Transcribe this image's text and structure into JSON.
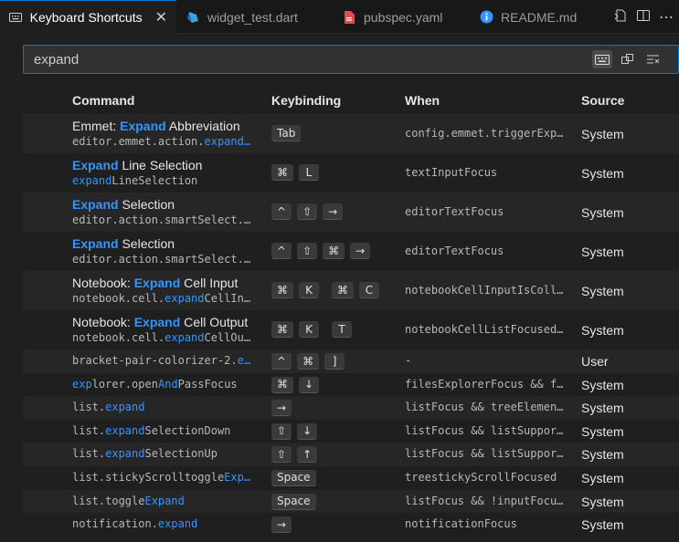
{
  "tabs": [
    {
      "label": "Keyboard Shortcuts",
      "icon": "keyboard-icon",
      "active": true
    },
    {
      "label": "widget_test.dart",
      "icon": "dart-file-icon"
    },
    {
      "label": "pubspec.yaml",
      "icon": "yaml-file-icon"
    },
    {
      "label": "README.md",
      "icon": "info-icon"
    }
  ],
  "search": {
    "value": "expand"
  },
  "headers": {
    "command": "Command",
    "keybinding": "Keybinding",
    "when": "When",
    "source": "Source"
  },
  "rows": [
    {
      "title_pre": "Emmet: ",
      "title_hl": "Expand",
      "title_post": " Abbreviation",
      "id_pre": "editor.emmet.action.",
      "id_hl": "expand…",
      "id_post": "",
      "keys": [
        [
          "Tab"
        ]
      ],
      "when": "config.emmet.triggerExp…",
      "source": "System"
    },
    {
      "title_pre": "",
      "title_hl": "Expand",
      "title_post": " Line Selection",
      "id_pre": "",
      "id_hl": "expand",
      "id_post": "LineSelection",
      "keys": [
        [
          "⌘",
          "L"
        ]
      ],
      "when": "textInputFocus",
      "source": "System"
    },
    {
      "title_pre": "",
      "title_hl": "Expand",
      "title_post": " Selection",
      "id_pre": "editor.action.smartSelect.…",
      "id_hl": "",
      "id_post": "",
      "keys": [
        [
          "^",
          "⇧",
          "→"
        ]
      ],
      "when": "editorTextFocus",
      "source": "System"
    },
    {
      "title_pre": "",
      "title_hl": "Expand",
      "title_post": " Selection",
      "id_pre": "editor.action.smartSelect.…",
      "id_hl": "",
      "id_post": "",
      "keys": [
        [
          "^",
          "⇧",
          "⌘",
          "→"
        ]
      ],
      "when": "editorTextFocus",
      "source": "System"
    },
    {
      "title_pre": "Notebook: ",
      "title_hl": "Expand",
      "title_post": " Cell Input",
      "id_pre": "notebook.cell.",
      "id_hl": "expand",
      "id_post": "CellIn…",
      "keys": [
        [
          "⌘",
          "K"
        ],
        [
          "⌘",
          "C"
        ]
      ],
      "when": "notebookCellInputIsColl…",
      "source": "System"
    },
    {
      "title_pre": "Notebook: ",
      "title_hl": "Expand",
      "title_post": " Cell Output",
      "id_pre": "notebook.cell.",
      "id_hl": "expand",
      "id_post": "CellOu…",
      "keys": [
        [
          "⌘",
          "K"
        ],
        [
          "T"
        ]
      ],
      "when": "notebookCellListFocused…",
      "source": "System"
    },
    {
      "id_pre": "bracket-pair-colorizer-2.",
      "id_hl": "e…",
      "id_post": "",
      "keys": [
        [
          "^",
          "⌘",
          "]"
        ]
      ],
      "when": "-",
      "source": "User"
    },
    {
      "id_pre": "",
      "id_hl": "exp",
      "id_post": "lorer.open",
      "id_hl2": "And",
      "id_post2": "PassFocus",
      "keys": [
        [
          "⌘",
          "↓"
        ]
      ],
      "when": "filesExplorerFocus && f…",
      "source": "System"
    },
    {
      "id_pre": "list.",
      "id_hl": "expand",
      "id_post": "",
      "keys": [
        [
          "→"
        ]
      ],
      "when": "listFocus && treeElemen…",
      "source": "System"
    },
    {
      "id_pre": "list.",
      "id_hl": "expand",
      "id_post": "SelectionDown",
      "keys": [
        [
          "⇧",
          "↓"
        ]
      ],
      "when": "listFocus && listSuppor…",
      "source": "System"
    },
    {
      "id_pre": "list.",
      "id_hl": "expand",
      "id_post": "SelectionUp",
      "keys": [
        [
          "⇧",
          "↑"
        ]
      ],
      "when": "listFocus && listSuppor…",
      "source": "System"
    },
    {
      "id_pre": "list.stickyScrolltoggle",
      "id_hl": "Exp…",
      "id_post": "",
      "keys": [
        [
          "Space"
        ]
      ],
      "when": "treestickyScrollFocused",
      "source": "System"
    },
    {
      "id_pre": "list.toggle",
      "id_hl": "Expand",
      "id_post": "",
      "keys": [
        [
          "Space"
        ]
      ],
      "when": "listFocus && !inputFocu…",
      "source": "System"
    },
    {
      "id_pre": "notification.",
      "id_hl": "expand",
      "id_post": "",
      "keys": [
        [
          "→"
        ]
      ],
      "when": "notificationFocus",
      "source": "System"
    }
  ],
  "colors": {
    "accent": "#0078d4",
    "highlight": "#3794ff"
  }
}
